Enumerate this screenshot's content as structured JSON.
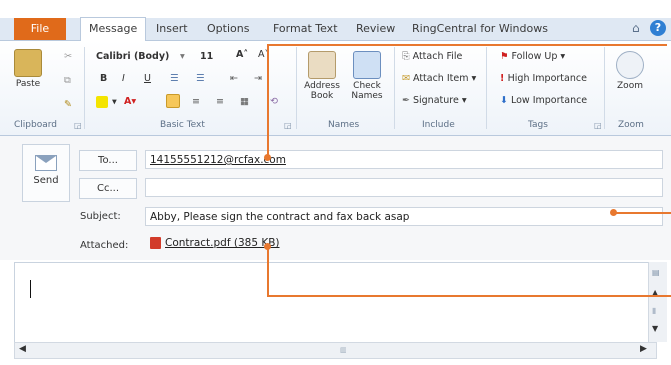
{
  "tabs": {
    "file": "File",
    "items": [
      "Message",
      "Insert",
      "Options",
      "Format Text",
      "Review",
      "RingCentral for Windows"
    ],
    "help_icon": "?"
  },
  "ribbon": {
    "clipboard": {
      "paste": "Paste",
      "label": "Clipboard"
    },
    "basic_text": {
      "font_name": "Calibri (Body)",
      "font_size": "11",
      "bold": "B",
      "italic": "I",
      "underline": "U",
      "label": "Basic Text"
    },
    "names": {
      "address_book": "Address Book",
      "check_names": "Check Names",
      "label": "Names"
    },
    "include": {
      "attach_file": "Attach File",
      "attach_item": "Attach Item",
      "signature": "Signature",
      "label": "Include"
    },
    "tags": {
      "follow_up": "Follow Up",
      "high_importance": "High Importance",
      "low_importance": "Low Importance",
      "label": "Tags"
    },
    "zoom": {
      "button": "Zoom",
      "label": "Zoom"
    }
  },
  "compose": {
    "send": "Send",
    "to_button": "To...",
    "cc_button": "Cc...",
    "to_value": "14155551212@rcfax.com",
    "cc_value": "",
    "subject_label": "Subject:",
    "subject_value": "Abby, Please sign the contract and fax back asap",
    "attached_label": "Attached:",
    "attachment": "Contract.pdf (385 KB)"
  },
  "colors": {
    "accent": "#e06a1a",
    "callout": "#e8782f"
  }
}
